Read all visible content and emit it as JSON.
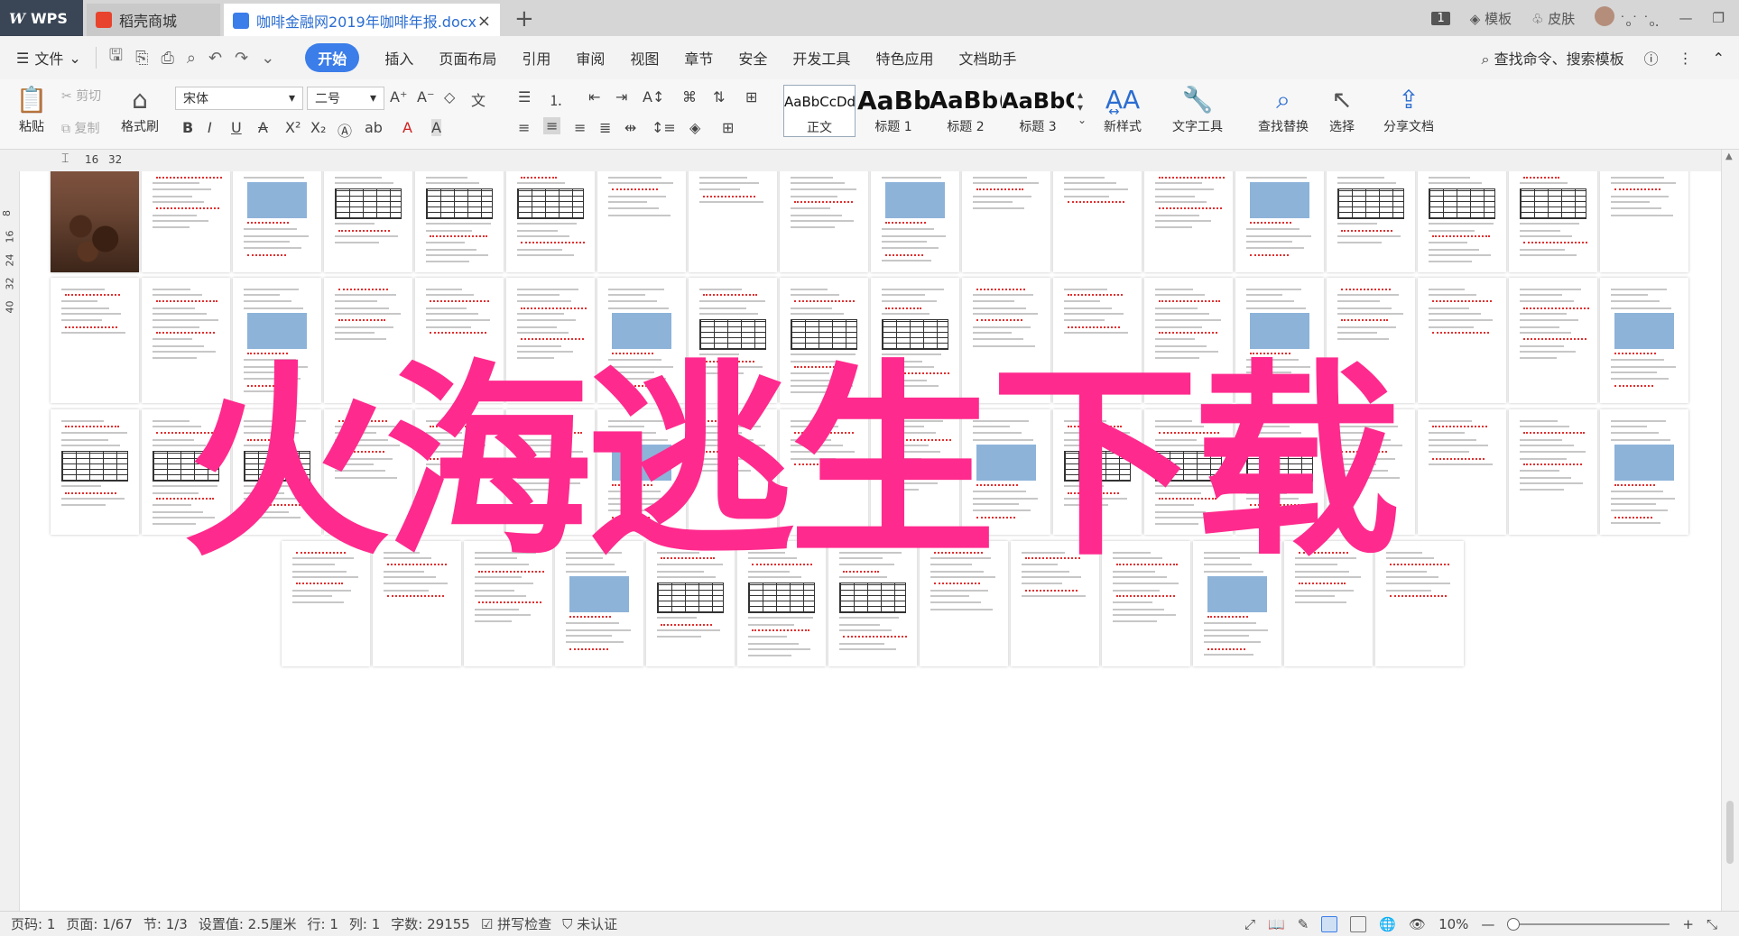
{
  "tabs": {
    "wps": "WPS",
    "store": "稻壳商城",
    "doc": "咖啡金融网2019年咖啡年报.docx",
    "close": "×",
    "new": "+"
  },
  "titlebar": {
    "badge": "1",
    "template": "模板",
    "skin": "皮肤",
    "user": "˙ₒ˙ ˙ₒ."
  },
  "menu": {
    "file": "文件",
    "items": [
      "开始",
      "插入",
      "页面布局",
      "引用",
      "审阅",
      "视图",
      "章节",
      "安全",
      "开发工具",
      "特色应用",
      "文档助手"
    ],
    "search": "查找命令、搜索模板"
  },
  "ribbon": {
    "paste": "粘贴",
    "cut": "剪切",
    "copy": "复制",
    "format_painter": "格式刷",
    "font_name": "宋体",
    "font_size": "二号",
    "styles": [
      {
        "sample": "AaBbCcDd",
        "name": "正文"
      },
      {
        "sample": "AaBb",
        "name": "标题 1"
      },
      {
        "sample": "AaBb(",
        "name": "标题 2"
      },
      {
        "sample": "AaBbC",
        "name": "标题 3"
      }
    ],
    "new_style": "新样式",
    "text_tools": "文字工具",
    "find_replace": "查找替换",
    "select": "选择",
    "share": "分享文档"
  },
  "ruler": {
    "h": [
      "16",
      "32"
    ],
    "v": [
      "8",
      "16",
      "24",
      "32",
      "40"
    ]
  },
  "watermark": "火海逃生下载",
  "status": {
    "page_num": "页码: 1",
    "page": "页面: 1/67",
    "section": "节: 1/3",
    "setting": "设置值: 2.5厘米",
    "line": "行: 1",
    "col": "列: 1",
    "words": "字数: 29155",
    "spell": "拼写检查",
    "auth": "未认证",
    "zoom": "10%"
  },
  "colors": {
    "accent": "#3b7de9",
    "watermark": "#ff2a8d",
    "wps_tab": "#3a4656"
  }
}
